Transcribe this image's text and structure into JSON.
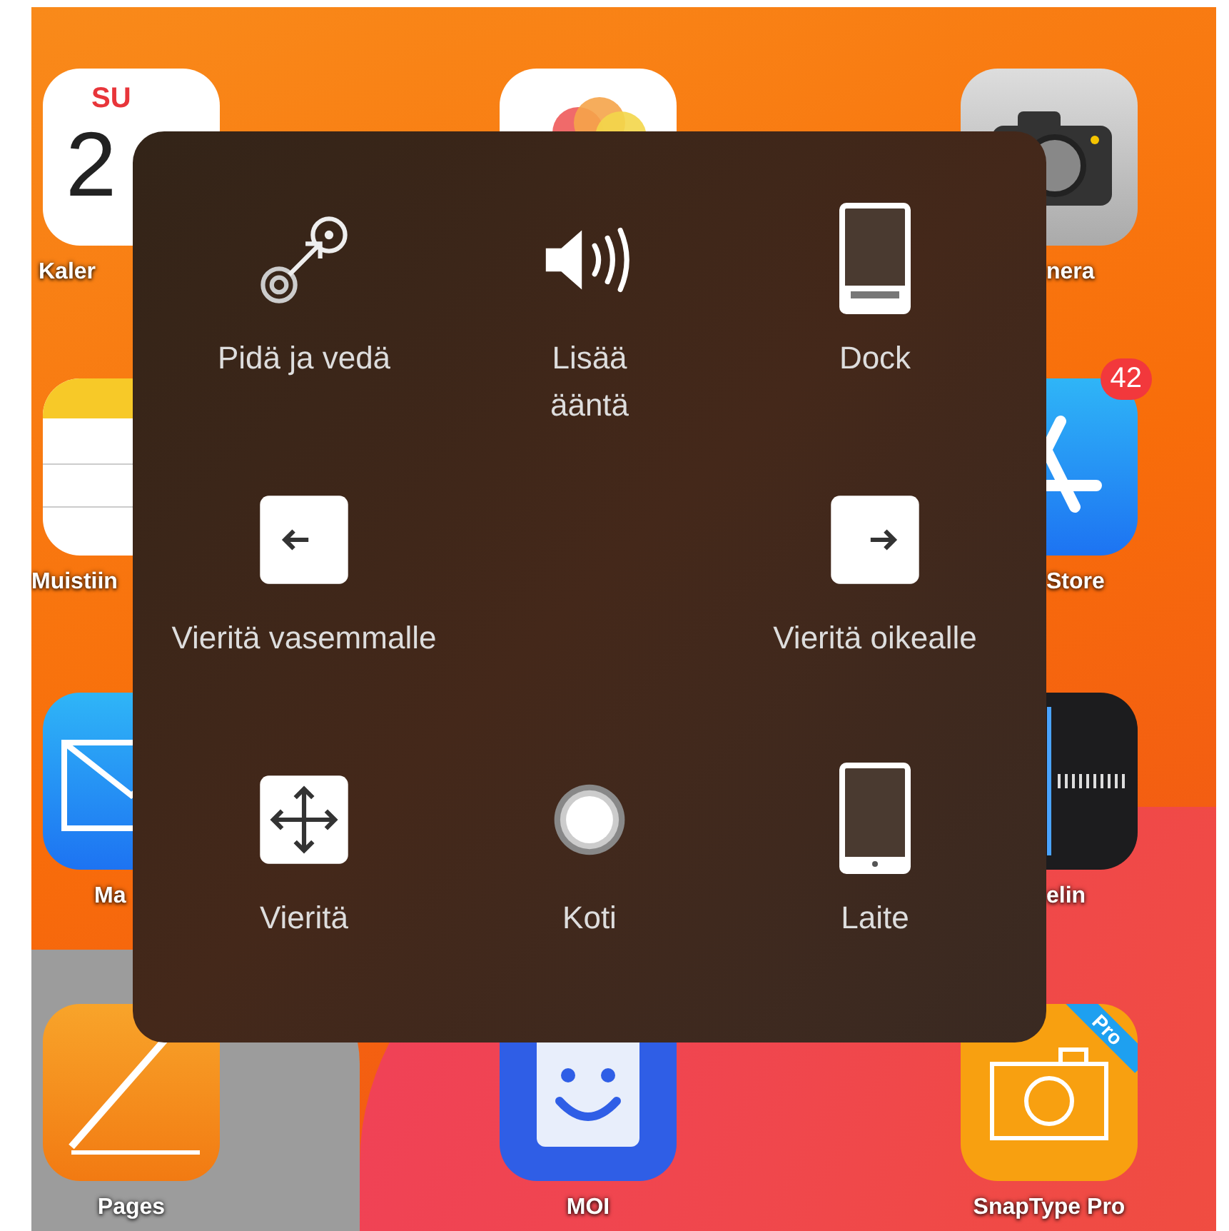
{
  "home_screen": {
    "apps": [
      {
        "kind": "calendar",
        "day": "SU",
        "date": "2",
        "label": "Kaler"
      },
      {
        "kind": "photos"
      },
      {
        "kind": "camera",
        "label": "nera"
      },
      {
        "kind": "notes",
        "label": "Muistiin"
      },
      {
        "kind": "appstore",
        "label": "Store",
        "badge": "42"
      },
      {
        "kind": "mail",
        "label": "Ma"
      },
      {
        "kind": "voice",
        "label": "elin"
      },
      {
        "kind": "pages",
        "label": "Pages"
      },
      {
        "kind": "moi",
        "label": "MOI"
      },
      {
        "kind": "snaptype",
        "label": "SnapType Pro",
        "ribbon": "Pro"
      }
    ]
  },
  "assistive_menu": {
    "rows": [
      [
        {
          "kind": "drag",
          "label": "Pidä ja vedä"
        },
        {
          "kind": "volume",
          "label": "Lisää\nääntä"
        },
        {
          "kind": "dock",
          "label": "Dock"
        }
      ],
      [
        {
          "kind": "scroll-left",
          "label": "Vieritä vasemmalle"
        },
        "",
        {
          "kind": "scroll-right",
          "label": "Vieritä oikealle"
        }
      ],
      [
        {
          "kind": "scroll",
          "label": "Vieritä"
        },
        {
          "kind": "home",
          "label": "Koti"
        },
        {
          "kind": "device",
          "label": "Laite"
        }
      ]
    ]
  }
}
